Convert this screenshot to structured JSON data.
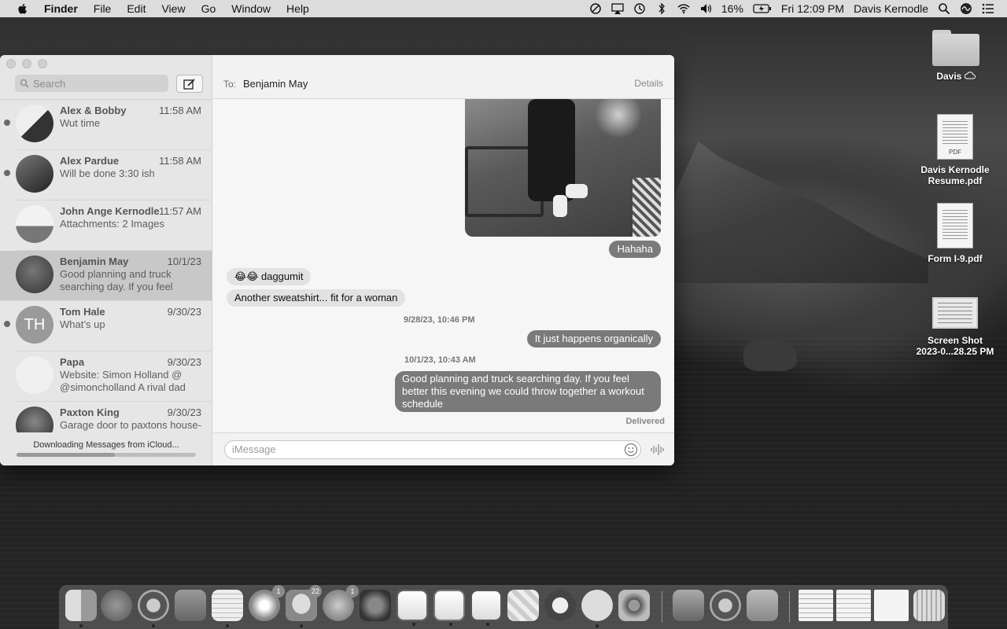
{
  "menubar": {
    "app_name": "Finder",
    "menus": [
      "File",
      "Edit",
      "View",
      "Go",
      "Window",
      "Help"
    ],
    "battery_percent": "16%",
    "clock": "Fri 12:09 PM",
    "user": "Davis Kernodle"
  },
  "desktop": {
    "icons": [
      {
        "label": "Davis",
        "icon": "folder-icon"
      },
      {
        "label": "Davis Kernodle Resume.pdf",
        "line1": "Davis Kernodle",
        "line2": "Resume.pdf",
        "icon": "pdf-document-icon",
        "tag": "PDF"
      },
      {
        "label": "Form I-9.pdf",
        "icon": "pdf-document-icon"
      },
      {
        "label": "Screen Shot 2023-0...28.25 PM",
        "line1": "Screen Shot",
        "line2": "2023-0...28.25 PM",
        "icon": "screenshot-icon"
      }
    ]
  },
  "messages": {
    "search_placeholder": "Search",
    "download_status": "Downloading Messages from iCloud...",
    "download_progress": 0.55,
    "conversations": [
      {
        "name": "Alex & Bobby",
        "time": "11:58 AM",
        "preview": "Wut time",
        "unread": true
      },
      {
        "name": "Alex Pardue",
        "time": "11:58 AM",
        "preview": "Will be done 3:30 ish",
        "unread": true
      },
      {
        "name": "John Ange Kernodle",
        "time": "11:57 AM",
        "preview": "Attachments: 2 Images",
        "unread": false
      },
      {
        "name": "Benjamin May",
        "time": "10/1/23",
        "preview": "Good planning and truck searching day. If you feel bette...",
        "unread": false,
        "selected": true
      },
      {
        "name": "Tom Hale",
        "time": "9/30/23",
        "preview": "What’s up",
        "unread": true,
        "initials": "TH"
      },
      {
        "name": "Papa",
        "time": "9/30/23",
        "preview": "Website: Simon Holland @ @simoncholland A rival dad tol...",
        "unread": false
      },
      {
        "name": "Paxton King",
        "time": "9/30/23",
        "preview": "Garage door to paxtons house-",
        "unread": false
      }
    ],
    "chat": {
      "to_label": "To:",
      "recipient": "Benjamin May",
      "details_label": "Details",
      "messages": [
        {
          "text": "Hahaha",
          "dir": "out"
        },
        {
          "text": "😂😂 daggumit",
          "dir": "in"
        },
        {
          "text": "Another sweatshirt... fit for a woman",
          "dir": "in"
        },
        {
          "text": "9/28/23, 10:46 PM",
          "dir": "timestamp"
        },
        {
          "text": "It just happens organically",
          "dir": "out"
        },
        {
          "text": "10/1/23, 10:43 AM",
          "dir": "timestamp"
        },
        {
          "text": "Good planning and truck searching day. If you feel better this evening we could throw together a workout schedule",
          "dir": "out"
        }
      ],
      "delivered": "Delivered",
      "composer_placeholder": "iMessage"
    }
  },
  "dock": {
    "apps": [
      {
        "name": "Finder",
        "icon": "finder-icon",
        "running": true
      },
      {
        "name": "Launchpad",
        "icon": "launchpad-icon"
      },
      {
        "name": "Chrome",
        "icon": "chrome-icon",
        "running": true
      },
      {
        "name": "Mail",
        "icon": "mail-icon"
      },
      {
        "name": "Notes",
        "icon": "notes-icon",
        "running": true
      },
      {
        "name": "Photos",
        "icon": "photos-icon",
        "badge": "1"
      },
      {
        "name": "Messages",
        "icon": "messages-icon",
        "badge": "22",
        "running": true
      },
      {
        "name": "App Store",
        "icon": "app-store-icon",
        "badge": "1"
      },
      {
        "name": "System Preferences",
        "icon": "system-preferences-icon"
      },
      {
        "name": "Word",
        "icon": "word-icon",
        "running": true
      },
      {
        "name": "PowerPoint",
        "icon": "powerpoint-icon",
        "running": true
      },
      {
        "name": "Excel",
        "icon": "excel-icon",
        "running": true
      },
      {
        "name": "Stickies",
        "icon": "stickies-icon"
      },
      {
        "name": "News",
        "icon": "news-icon"
      },
      {
        "name": "Spotify",
        "icon": "spotify-icon",
        "running": true
      },
      {
        "name": "Disk Utility",
        "icon": "disk-utility-icon"
      },
      {
        "name": "Preview",
        "icon": "preview-icon"
      },
      {
        "name": "Chrome Apps",
        "icon": "chrome-apps-icon"
      },
      {
        "name": "FaceTime",
        "icon": "facetime-icon"
      },
      {
        "name": "Minimized Window 1",
        "icon": "window-thumbnail-icon"
      },
      {
        "name": "Minimized Window 2",
        "icon": "window-thumbnail-icon"
      },
      {
        "name": "Minimized Window 3",
        "icon": "window-thumbnail-icon"
      },
      {
        "name": "Trash",
        "icon": "trash-icon"
      }
    ]
  }
}
